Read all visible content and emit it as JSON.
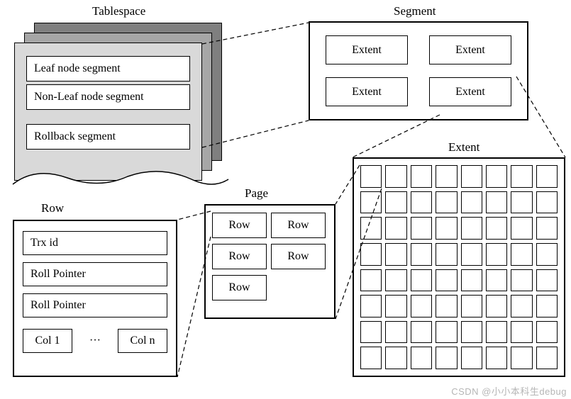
{
  "tablespace": {
    "title": "Tablespace",
    "segments": [
      "Leaf node segment",
      "Non-Leaf node segment",
      "Rollback segment"
    ]
  },
  "segment": {
    "title": "Segment",
    "extent_label": "Extent"
  },
  "extent": {
    "title": "Extent",
    "grid_rows": 8,
    "grid_cols": 8
  },
  "page": {
    "title": "Page",
    "row_label": "Row"
  },
  "row": {
    "title": "Row",
    "fields": [
      "Trx id",
      "Roll Pointer",
      "Roll Pointer"
    ],
    "col_first": "Col 1",
    "col_dots": "···",
    "col_last": "Col n"
  },
  "watermark": "CSDN @小小本科生debug"
}
